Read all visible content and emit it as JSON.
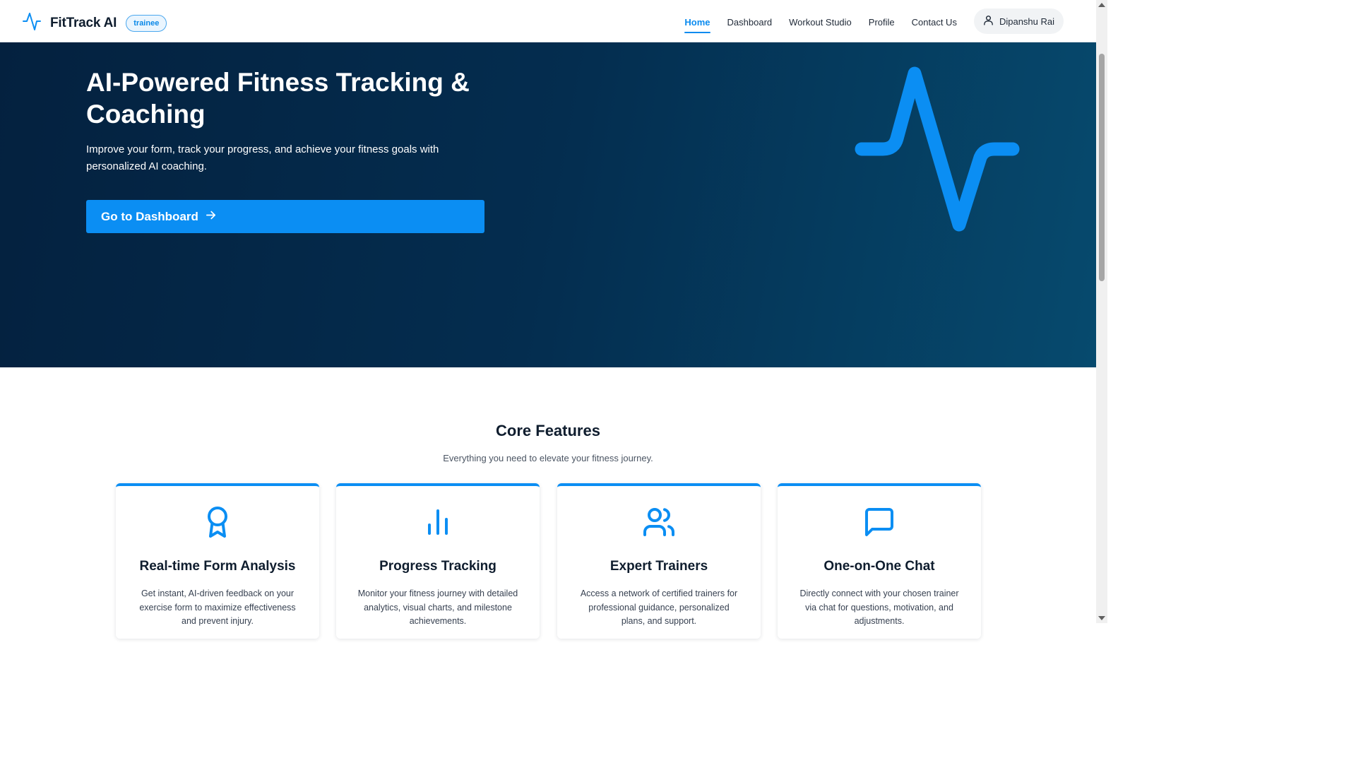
{
  "header": {
    "brand_name": "FitTrack AI",
    "role_badge": "trainee",
    "nav": [
      {
        "label": "Home",
        "active": true
      },
      {
        "label": "Dashboard",
        "active": false
      },
      {
        "label": "Workout Studio",
        "active": false
      },
      {
        "label": "Profile",
        "active": false
      },
      {
        "label": "Contact Us",
        "active": false
      }
    ],
    "user_name": "Dipanshu Rai"
  },
  "hero": {
    "title": "AI-Powered Fitness Tracking & Coaching",
    "subtitle": "Improve your form, track your progress, and achieve your fitness goals with personalized AI coaching.",
    "cta_label": "Go to Dashboard",
    "decor_icon": "activity-pulse-icon"
  },
  "features": {
    "title": "Core Features",
    "subtitle": "Everything you need to elevate your fitness journey.",
    "cards": [
      {
        "icon": "award-icon",
        "title": "Real-time Form Analysis",
        "description": "Get instant, AI-driven feedback on your exercise form to maximize effectiveness and prevent injury."
      },
      {
        "icon": "bar-chart-icon",
        "title": "Progress Tracking",
        "description": "Monitor your fitness journey with detailed analytics, visual charts, and milestone achievements."
      },
      {
        "icon": "users-icon",
        "title": "Expert Trainers",
        "description": "Access a network of certified trainers for professional guidance, personalized plans, and support."
      },
      {
        "icon": "message-square-icon",
        "title": "One-on-One Chat",
        "description": "Directly connect with your chosen trainer via chat for questions, motivation, and adjustments."
      }
    ]
  },
  "colors": {
    "accent": "#0b8ef3",
    "hero_dark": "#04213f",
    "hero_light": "#064a6e",
    "heading": "#0f1d2e"
  }
}
